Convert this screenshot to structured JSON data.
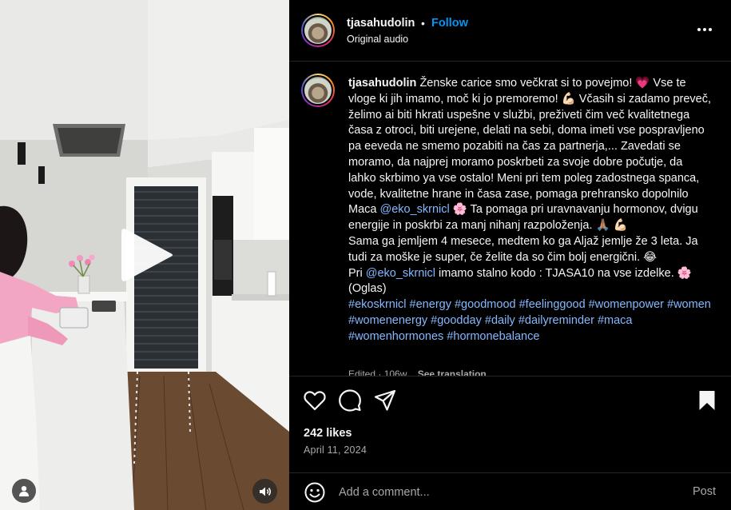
{
  "header": {
    "username": "tjasahudolin",
    "separator": "•",
    "follow_label": "Follow",
    "audio": "Original audio",
    "more_icon": "more-horizontal-icon"
  },
  "caption": {
    "username": "tjasahudolin",
    "p1": "Ženske carice smo večkrat si to povejmo! 💗 Vse te vloge ki jih imamo, moč ki jo premoremo! 💪🏻  Včasih si zadamo preveč, želimo ai biti hkrati uspešne v službi, preživeti čim več kvalitetnega časa z otroci, biti urejene, delati na sebi, doma imeti vse pospravljeno pa eeveda ne smemo pozabiti na čas za partnerja,... Zavedati se moramo, da najprej moramo poskrbeti za svoje dobre počutje, da lahko skrbimo ya vse ostalo! Meni pri tem poleg zadostnega spanca, vode, kvalitetne hrane in časa zase, pomaga prehransko dopolnilo Maca",
    "mention1": "@eko_skrnicl",
    "p2": " 🌸 Ta pomaga pri uravnavanju hormonov, dvigu energije in poskrbi za manj nihanj razpoloženja. 🙏🏽 💪🏻",
    "p3": "Sama ga jemljem 4 mesece, medtem ko ga Aljaž jemlje že 3 leta. Ja tudi za moške je super, če želite da so čim bolj energični. 😂",
    "p4a": "Pri ",
    "mention2": "@eko_skrnicl",
    "p4b": " imamo stalno kodo : TJASA10 na vse izdelke. 🌸",
    "p5": "(Oglas)",
    "hashtags": "#ekoskrnicl #energy #goodmood #feelinggood #womenpower #women #womenenergy #goodday #daily #dailyreminder #maca #womenhormones #hormonebalance",
    "edited": "Edited · 106w",
    "see_translation": "See translation"
  },
  "actions": {
    "like_icon": "heart-icon",
    "comment_icon": "comment-icon",
    "share_icon": "share-icon",
    "save_icon": "bookmark-icon",
    "likes": "242 likes",
    "date": "April 11, 2024"
  },
  "comment": {
    "placeholder": "Add a comment...",
    "post_label": "Post",
    "emoji_icon": "emoji-icon"
  },
  "video": {
    "play_icon": "play-icon",
    "user_icon": "user-icon",
    "volume_icon": "volume-icon"
  }
}
